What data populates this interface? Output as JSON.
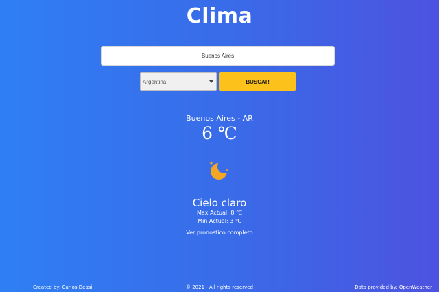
{
  "app": {
    "title": "Clima"
  },
  "search": {
    "city_value": "Buenos Aires",
    "country_selected": "Argentina",
    "button_label": "BUSCAR"
  },
  "weather": {
    "location": "Buenos Aires - AR",
    "temperature": "6 ℃",
    "icon": "moon-stars-icon",
    "description": "Cielo claro",
    "max_temp": "Max Actual: 8 ℃",
    "min_temp": "Min Actual: 3 ℃",
    "forecast_link": "Ver pronostico completo"
  },
  "footer": {
    "created_by": "Created by: Carlos Deasi",
    "rights": "© 2021 - All rights reserved",
    "data_provider": "Data provided by: OpenWeather"
  },
  "colors": {
    "background_start": "#2f7ff4",
    "background_end": "#4d52df",
    "button": "#fcc21b",
    "icon": "#f5a623"
  }
}
